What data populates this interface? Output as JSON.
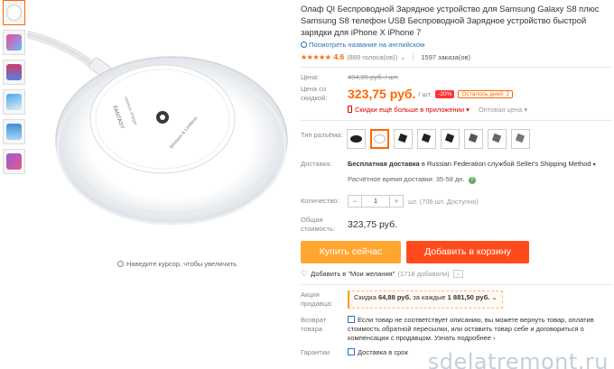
{
  "product": {
    "title": "Олаф QI Беспроводной Зарядное устройство для Samsung Galaxy S8 плюс Samsung S8 телефон USB Беспроводной Зарядное устройство быстрой зарядки для iPhone X iPhone 7",
    "translate_link": "Посмотреть название на английском",
    "rating_value": "4.6",
    "rating_stars": "★★★★★",
    "votes": "(889 голоса(ов))",
    "votes_caret": "⌄",
    "orders": "1597 заказа(ов)"
  },
  "price": {
    "old_label": "Цена:",
    "old_value": "404,85 руб. / шт.",
    "disc_label": "Цена со скидкой:",
    "value": "323,75 руб.",
    "unit": "/ шт.",
    "discount": "-20%",
    "days_left": "Осталось дней: 2",
    "app_discount": "Скидки ещё больше в приложении",
    "app_caret": "▾",
    "wholesale": "Оптовая цена",
    "wholesale_caret": "▾"
  },
  "connector": {
    "label": "Тип разъёма:"
  },
  "shipping": {
    "label": "Доставка:",
    "text_bold": "Бесплатная доставка",
    "text_rest": " в Russian Federation службой Seller's Shipping Method",
    "caret": "▾",
    "time_prefix": "Расчётное время доставки: ",
    "time_value": "35-58",
    "time_suffix": " дн.",
    "help": "?"
  },
  "quantity": {
    "label": "Количество:",
    "minus": "−",
    "value": "1",
    "plus": "+",
    "note": "шт. (706 шт. Доступно)"
  },
  "total": {
    "label": "Общая стоимость:",
    "value": "323,75 руб."
  },
  "actions": {
    "buy_now": "Купить сейчас",
    "add_to_cart": "Добавить в корзину"
  },
  "wishlist": {
    "heart": "♡",
    "text": "Добавить в \"Мои желания\"",
    "count": "(1718 добавили)",
    "caret": "⌄"
  },
  "seller_promo": {
    "label": "Акция продавца:",
    "text_prefix": "Скидка ",
    "amount": "64,88 руб.",
    "text_mid": " за каждые ",
    "threshold": "1 881,50 руб.",
    "caret": "⌄"
  },
  "returns": {
    "label": "Возврат товара",
    "text": "Если товар не соответствует описанию, вы можете вернуть товар, оплатив стоимость обратной пересылки, или оставить товар себе и договориться о компенсации с продавцом. Узнать подробнее ›"
  },
  "guarantee": {
    "label": "Гарантии",
    "text": "Доставка в срок"
  },
  "image": {
    "zoom_hint": "Наведите курсор, чтобы увеличить",
    "pad_text_1": "Wireless & Limitless",
    "pad_text_2": "wireless charger",
    "pad_brand": "FANTASY"
  },
  "watermark": "sdelatremont.ru",
  "colors": {
    "accent": "#ff6600",
    "buy_now": "#ffa631",
    "cart": "#ff4b1c",
    "discount_badge": "#ff3333",
    "link": "#2c6fbd"
  }
}
